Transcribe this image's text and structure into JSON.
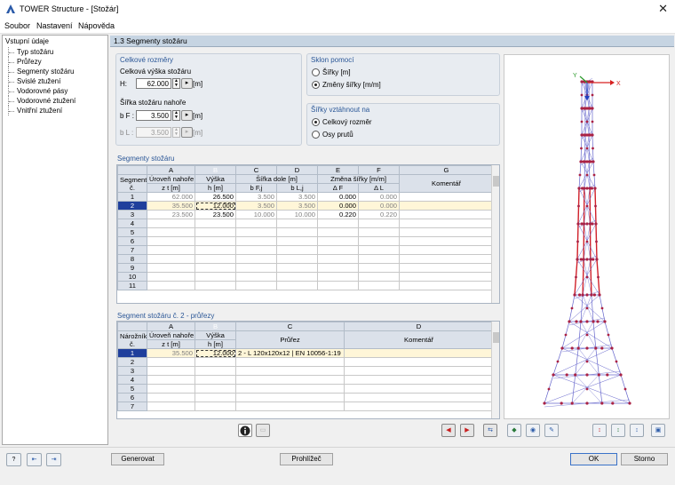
{
  "window": {
    "title": "TOWER Structure - [Stožár]",
    "close": "✕"
  },
  "menu": [
    "Soubor",
    "Nastavení",
    "Nápověda"
  ],
  "nav": {
    "root": "Vstupní údaje",
    "items": [
      "Typ stožáru",
      "Průřezy",
      "Segmenty stožáru",
      "Svislé ztužení",
      "Vodorovné pásy",
      "Vodorovné ztužení",
      "Vnitřní ztužení"
    ]
  },
  "section_title": "1.3 Segmenty stožáru",
  "dims": {
    "title": "Celkové rozměry",
    "height_label": "Celková výška stožáru",
    "h_label": "H:",
    "h_value": "62.000",
    "h_unit": "[m]",
    "top_width_label": "Šířka stožáru nahoře",
    "bf_label": "b F :",
    "bf_value": "3.500",
    "bf_unit": "[m]",
    "bl_label": "b L :",
    "bl_value": "3.500",
    "bl_unit": "[m]"
  },
  "slope": {
    "title": "Sklon pomocí",
    "opt1": "Šířky [m]",
    "opt2": "Změny šířky [m/m]"
  },
  "widths": {
    "title": "Šířky vztáhnout na",
    "opt1": "Celkový rozměr",
    "opt2": "Osy prutů"
  },
  "segments": {
    "title": "Segmenty stožáru",
    "letters": [
      "A",
      "B",
      "C",
      "D",
      "E",
      "F",
      "G"
    ],
    "h1": [
      "Segment č.",
      "Úroveň nahoře",
      "Výška",
      "Šířka dole [m]",
      "",
      "Změna šířky [m/m]",
      "",
      "Komentář"
    ],
    "h2": [
      "",
      "z t [m]",
      "h [m]",
      "b F,j",
      "b L,j",
      "Δ F",
      "Δ L",
      ""
    ],
    "rows": [
      [
        "1",
        "62.000",
        "26.500",
        "3.500",
        "3.500",
        "0.000",
        "0.000",
        ""
      ],
      [
        "2",
        "35.500",
        "12.000",
        "3.500",
        "3.500",
        "0.000",
        "0.000",
        ""
      ],
      [
        "3",
        "23.500",
        "23.500",
        "10.000",
        "10.000",
        "0.220",
        "0.220",
        ""
      ],
      [
        "4",
        "",
        "",
        "",
        "",
        "",
        "",
        ""
      ],
      [
        "5",
        "",
        "",
        "",
        "",
        "",
        "",
        ""
      ],
      [
        "6",
        "",
        "",
        "",
        "",
        "",
        "",
        ""
      ],
      [
        "7",
        "",
        "",
        "",
        "",
        "",
        "",
        ""
      ],
      [
        "8",
        "",
        "",
        "",
        "",
        "",
        "",
        ""
      ],
      [
        "9",
        "",
        "",
        "",
        "",
        "",
        "",
        ""
      ],
      [
        "10",
        "",
        "",
        "",
        "",
        "",
        "",
        ""
      ],
      [
        "11",
        "",
        "",
        "",
        "",
        "",
        "",
        ""
      ]
    ]
  },
  "cross": {
    "title": "Segment stožáru č. 2 - průřezy",
    "letters": [
      "A",
      "B",
      "C",
      "D"
    ],
    "h1": [
      "Nárožník č.",
      "Úroveň nahoře",
      "Výška",
      "Průřez",
      "Komentář"
    ],
    "h2": [
      "",
      "z t [m]",
      "h [m]",
      "",
      ""
    ],
    "rows": [
      [
        "1",
        "35.500",
        "12.000",
        "2 - L 120x120x12 | EN 10056-1:19",
        ""
      ],
      [
        "2",
        "",
        "",
        "",
        ""
      ],
      [
        "3",
        "",
        "",
        "",
        ""
      ],
      [
        "4",
        "",
        "",
        "",
        ""
      ],
      [
        "5",
        "",
        "",
        "",
        ""
      ],
      [
        "6",
        "",
        "",
        "",
        ""
      ],
      [
        "7",
        "",
        "",
        "",
        ""
      ]
    ]
  },
  "axes": {
    "x": "X",
    "y": "Y"
  },
  "buttons": {
    "generate": "Generovat",
    "browse": "Prohlížeč",
    "ok": "OK",
    "cancel": "Storno"
  },
  "colors": {
    "header": "#c6d4e2",
    "selection": "#1f3f9c",
    "accent_red": "#d0202a",
    "tower_blue": "#6666cc",
    "nodes": "#aa2244"
  }
}
